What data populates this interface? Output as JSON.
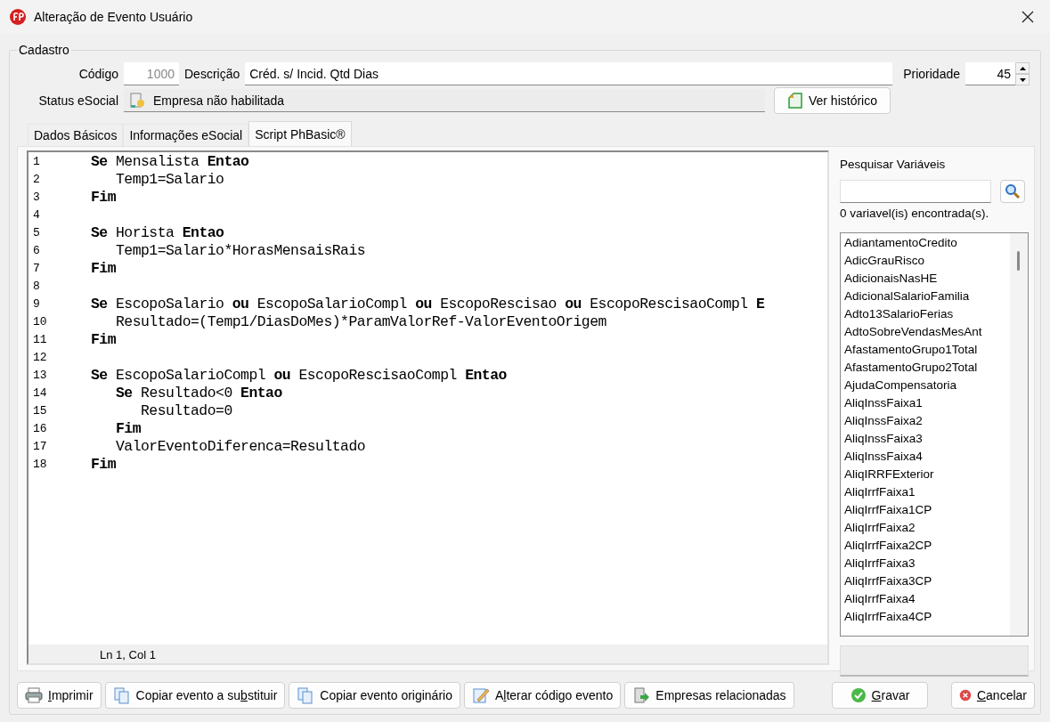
{
  "window": {
    "title": "Alteração de Evento Usuário"
  },
  "cadastro": {
    "legend": "Cadastro",
    "codigo": {
      "label": "Código",
      "value": "1000",
      "disabled": true
    },
    "descricao": {
      "label": "Descrição",
      "value": "Créd. s/ Incid. Qtd Dias"
    },
    "prioridade": {
      "label": "Prioridade",
      "value": "45"
    },
    "status": {
      "label": "Status eSocial",
      "value": "Empresa não habilitada"
    },
    "history_button": "Ver histórico"
  },
  "tabs": [
    {
      "label": "Dados Básicos",
      "selected": false
    },
    {
      "label": "Informações eSocial",
      "selected": false
    },
    {
      "label": "Script PhBasic®",
      "selected": true
    }
  ],
  "editor": {
    "lines": [
      {
        "number": "1",
        "code": "**Se** Mensalista **Entao**"
      },
      {
        "number": "2",
        "code": "   Temp1=Salario"
      },
      {
        "number": "3",
        "code": "**Fim**"
      },
      {
        "number": "4"
      },
      {
        "number": "5",
        "code": "**Se** Horista **Entao**"
      },
      {
        "number": "6",
        "code": "   Temp1=Salario*HorasMensaisRais"
      },
      {
        "number": "7",
        "code": "**Fim**"
      },
      {
        "number": "8"
      },
      {
        "number": "9",
        "code": "**Se** EscopoSalario **ou** EscopoSalarioCompl **ou** EscopoRescisao **ou** EscopoRescisaoCompl **E**"
      },
      {
        "number": "10",
        "code": "   Resultado=(Temp1/DiasDoMes)*ParamValorRef-ValorEventoOrigem"
      },
      {
        "number": "11",
        "code": "**Fim**"
      },
      {
        "number": "12"
      },
      {
        "number": "13",
        "code": "**Se** EscopoSalarioCompl **ou** EscopoRescisaoCompl **Entao**"
      },
      {
        "number": "14",
        "code": "   **Se** Resultado<0 **Entao**"
      },
      {
        "number": "15",
        "code": "      Resultado=0"
      },
      {
        "number": "16",
        "code": "   **Fim**"
      },
      {
        "number": "17",
        "code": "   ValorEventoDiferenca=Resultado"
      },
      {
        "number": "18",
        "code": "**Fim**"
      }
    ],
    "status": "Ln 1, Col 1"
  },
  "variables": {
    "title": "Pesquisar Variáveis",
    "count": "0 variavel(is) encontrada(s).",
    "items": [
      "AdiantamentoCredito",
      "AdicGrauRisco",
      "AdicionaisNasHE",
      "AdicionalSalarioFamilia",
      "Adto13SalarioFerias",
      "AdtoSobreVendasMesAnt",
      "AfastamentoGrupo1Total",
      "AfastamentoGrupo2Total",
      "AjudaCompensatoria",
      "AliqInssFaixa1",
      "AliqInssFaixa2",
      "AliqInssFaixa3",
      "AliqInssFaixa4",
      "AliqIRRFExterior",
      "AliqIrrfFaixa1",
      "AliqIrrfFaixa1CP",
      "AliqIrrfFaixa2",
      "AliqIrrfFaixa2CP",
      "AliqIrrfFaixa3",
      "AliqIrrfFaixa3CP",
      "AliqIrrfFaixa4",
      "AliqIrrfFaixa4CP"
    ]
  },
  "buttons": [
    {
      "kind": "print",
      "key": "I",
      "after": "mprimir"
    },
    {
      "kind": "copy",
      "before": "Copiar evento a su",
      "key": "b",
      "after": "stituir"
    },
    {
      "kind": "copy",
      "before": "Copiar evento originário"
    },
    {
      "kind": "edit",
      "before": "A",
      "key": "l",
      "after": "terar código evento"
    },
    {
      "kind": "companies",
      "before": "Empresas relacionadas"
    },
    {
      "kind": "save",
      "key": "G",
      "after": "ravar"
    },
    {
      "kind": "cancel",
      "key": "C",
      "after": "ancelar"
    }
  ]
}
